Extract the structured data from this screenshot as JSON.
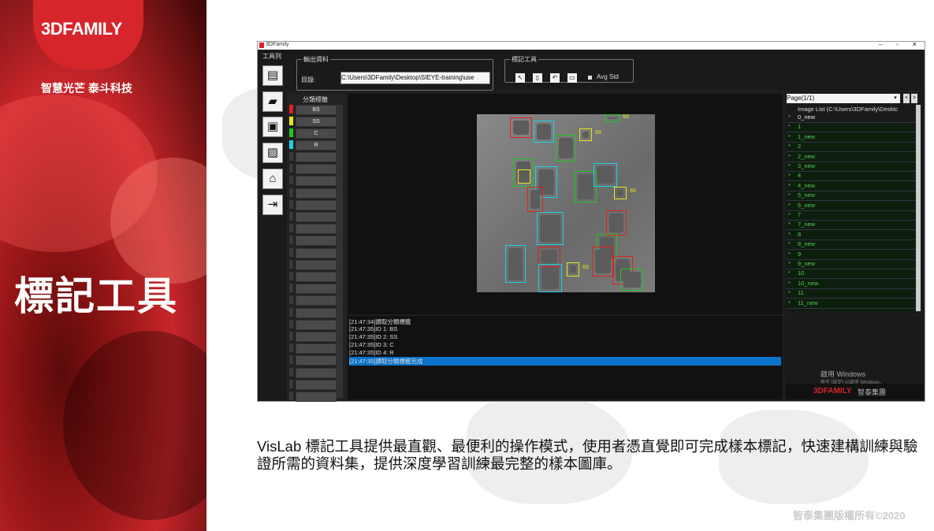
{
  "brand": {
    "logo": "3DFAMILY",
    "slogan": "智慧光芒 泰斗科技"
  },
  "slide_title": "標記工具",
  "window": {
    "title": "3DFamily",
    "toolbar_label": "工具列",
    "output_group": "輸出資料",
    "dir_label": "目錄:",
    "dir_value": "C:\\Users\\3DFamily\\Desktop\\SIEYE-training\\use",
    "mark_group": "標記工具",
    "avg_std": "Avg Std",
    "label_panel_title": "分類標籤",
    "labels": [
      {
        "name": "BS",
        "color": "#e0201c"
      },
      {
        "name": "SS",
        "color": "#e8e81a"
      },
      {
        "name": "C",
        "color": "#1ec81e"
      },
      {
        "name": "R",
        "color": "#1ad2e6"
      }
    ],
    "ss_tag": "SS",
    "log": [
      "[21:47:34]讀取分類標籤",
      "[21:47:35]ID 1: BS",
      "[21:47:35]ID 2: SS",
      "[21:47:35]ID 3: C",
      "[21:47:35]ID 4: R",
      "[21:47:35]讀取分類標籤完成"
    ],
    "page_select": "Page(1/1)",
    "image_list_header": "Image List (C:\\Users\\3DFamily\\Desktc",
    "image_list": [
      "0_new",
      "1",
      "1_new",
      "2",
      "2_new",
      "3_new",
      "4",
      "4_new",
      "5_new",
      "6_new",
      "7",
      "7_new",
      "8",
      "8_new",
      "9",
      "9_new",
      "10",
      "10_new",
      "11",
      "11_new"
    ],
    "watermark_1": "啟用 Windows",
    "watermark_2": "移至 [設定] 以啟用 Windows。",
    "bottom_logo": "3DFAMILY",
    "bottom_logo_cn": "智泰集團"
  },
  "description": "VisLab 標記工具提供最直觀、最便利的操作模式，使用者憑直覺即可完成樣本標記，快速建構訓練與驗證所需的資料集，提供深度學習訓練最完整的樣本圖庫。",
  "copyright": "智泰集團版權所有©2020"
}
